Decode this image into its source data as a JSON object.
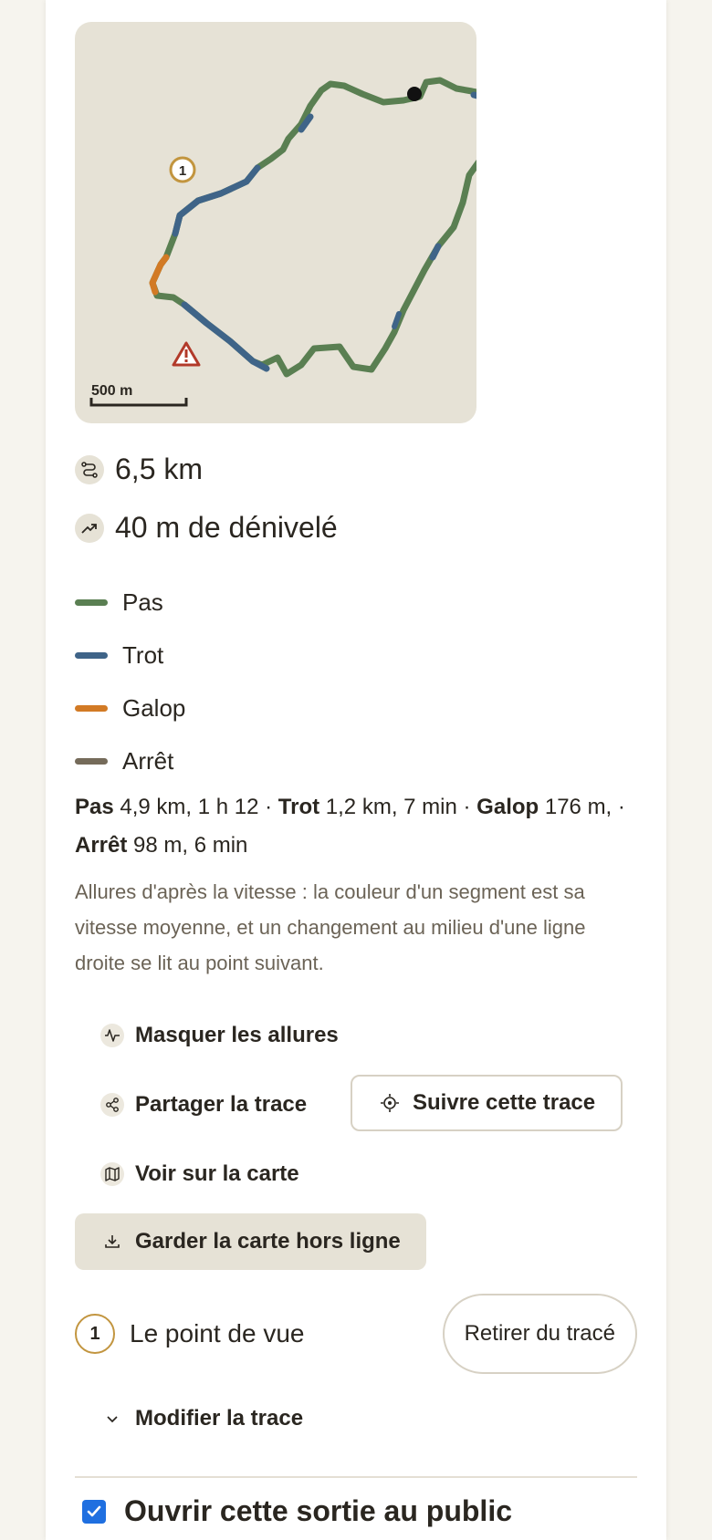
{
  "map": {
    "scale_label": "500 m",
    "poi_marker_number": "1",
    "colors": {
      "pas": "#5a7f52",
      "trot": "#3f6488",
      "galop": "#d27a25",
      "arret": "#756b5a"
    }
  },
  "stats": {
    "distance": "6,5 km",
    "elevation": "40 m de dénivelé"
  },
  "legend": [
    {
      "label": "Pas",
      "color": "#5a7f52"
    },
    {
      "label": "Trot",
      "color": "#3f6488"
    },
    {
      "label": "Galop",
      "color": "#d27a25"
    },
    {
      "label": "Arrêt",
      "color": "#756b5a"
    }
  ],
  "summary": {
    "pas_label": "Pas",
    "pas_value": " 4,9 km, 1 h 12 · ",
    "trot_label": "Trot",
    "trot_value": " 1,2 km, 7 min · ",
    "galop_label": "Galop",
    "galop_value": " 176 m, · ",
    "arret_label": "Arrêt",
    "arret_value": " 98 m, 6 min"
  },
  "note": "Allures d'après la vitesse : la couleur d'un segment est sa vitesse moyenne, et un changement au milieu d'une ligne droite se lit au point suivant.",
  "actions": {
    "hide_gaits": "Masquer les allures",
    "share": "Partager la trace",
    "follow": "Suivre cette trace",
    "view_map": "Voir sur la carte",
    "offline": "Garder la carte hors ligne"
  },
  "poi": {
    "number": "1",
    "name": "Le point de vue",
    "remove": "Retirer du tracé"
  },
  "edit": {
    "label": "Modifier la trace"
  },
  "public": {
    "label": "Ouvrir cette sortie au public",
    "checked": true
  }
}
